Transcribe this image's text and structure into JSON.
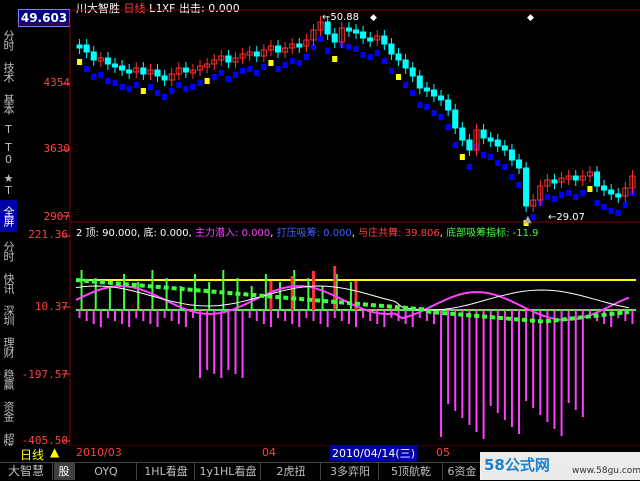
{
  "title": {
    "stock_name": "川大智胜",
    "period": "日线",
    "formula": "L1XF",
    "out_label": "出击:",
    "out_value": "0.000"
  },
  "price_box": "49.603",
  "price_axis": [
    "4354",
    "3630",
    "2907"
  ],
  "price_annotations": {
    "high": "50.88",
    "low": "29.07"
  },
  "indicator_bar": {
    "top_label": "2 顶:",
    "top_value": "90.000",
    "bottom_label": "底:",
    "bottom_value": "0.000",
    "main_in_label": "主力潜入:",
    "main_in_value": "0.000",
    "absorb_label": "打压吸筹:",
    "absorb_value": "0.000",
    "dance_label": "与庄共舞:",
    "dance_value": "39.806",
    "base_label": "底部吸筹指标:",
    "base_value": "-11.9"
  },
  "indicator_axis": [
    "221.36",
    "10.37",
    "-197.57",
    "-405.50"
  ],
  "left_tabs": [
    "分时",
    "技术",
    "基本",
    "T",
    "T0",
    "★T",
    "全屏",
    "分时",
    "快讯",
    "深圳",
    "理财",
    "稳赢",
    "资金",
    "超级",
    "龙",
    "牛"
  ],
  "time_axis": {
    "start": "2010/03",
    "m04": "04",
    "cursor": "2010/04/14(三)",
    "m05": "05"
  },
  "period_indicator": "日线",
  "bottom_tabs": [
    "大智慧",
    "股",
    "OYQ",
    "1HL看盘",
    "1y1HL看盘",
    "2虎扭",
    "3多弈阳",
    "5顶航乾",
    "6资金"
  ],
  "watermark": {
    "brand": "58公式网",
    "url": "www.58gu.com"
  },
  "colors": {
    "up": "#ff3030",
    "down": "#00ffff",
    "cloud": "#0000ff",
    "yellow": "#ffff00",
    "magenta": "#ff40ff",
    "green": "#40ff40"
  }
}
